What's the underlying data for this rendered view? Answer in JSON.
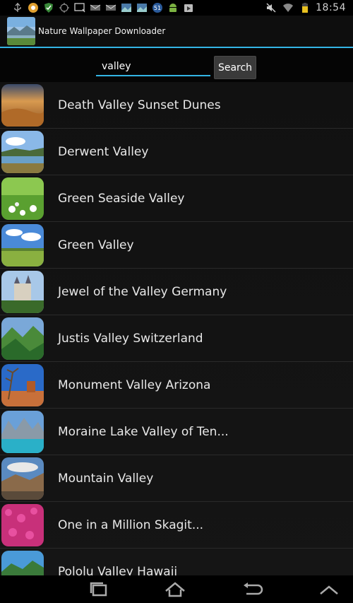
{
  "status_bar": {
    "time": "18:54",
    "left_icons": [
      "usb-icon",
      "circle-app-icon",
      "shield-icon",
      "gps-icon",
      "message-icon",
      "mail-icon",
      "mail2-icon",
      "photo-icon",
      "photo2-icon",
      "badge-51-icon",
      "android-icon",
      "play-store-icon"
    ],
    "badge_number": "51",
    "right_icons": [
      "mute-icon",
      "wifi-icon",
      "battery-icon"
    ]
  },
  "action_bar": {
    "title": "Nature Wallpaper Downloader"
  },
  "search": {
    "value": "valley",
    "button_label": "Search"
  },
  "results": [
    {
      "title": "Death Valley Sunset Dunes"
    },
    {
      "title": "Derwent Valley"
    },
    {
      "title": "Green Seaside Valley"
    },
    {
      "title": "Green Valley"
    },
    {
      "title": "Jewel of the Valley Germany"
    },
    {
      "title": "Justis Valley Switzerland"
    },
    {
      "title": "Monument Valley Arizona"
    },
    {
      "title": "Moraine Lake Valley of Ten..."
    },
    {
      "title": "Mountain Valley"
    },
    {
      "title": "One in a Million Skagit..."
    },
    {
      "title": "Pololu Valley Hawaii"
    }
  ],
  "nav_bar": {
    "icons": [
      "recent-apps-icon",
      "home-icon",
      "back-icon",
      "menu-up-icon"
    ]
  },
  "colors": {
    "accent": "#33b5e5",
    "background": "#000000"
  }
}
